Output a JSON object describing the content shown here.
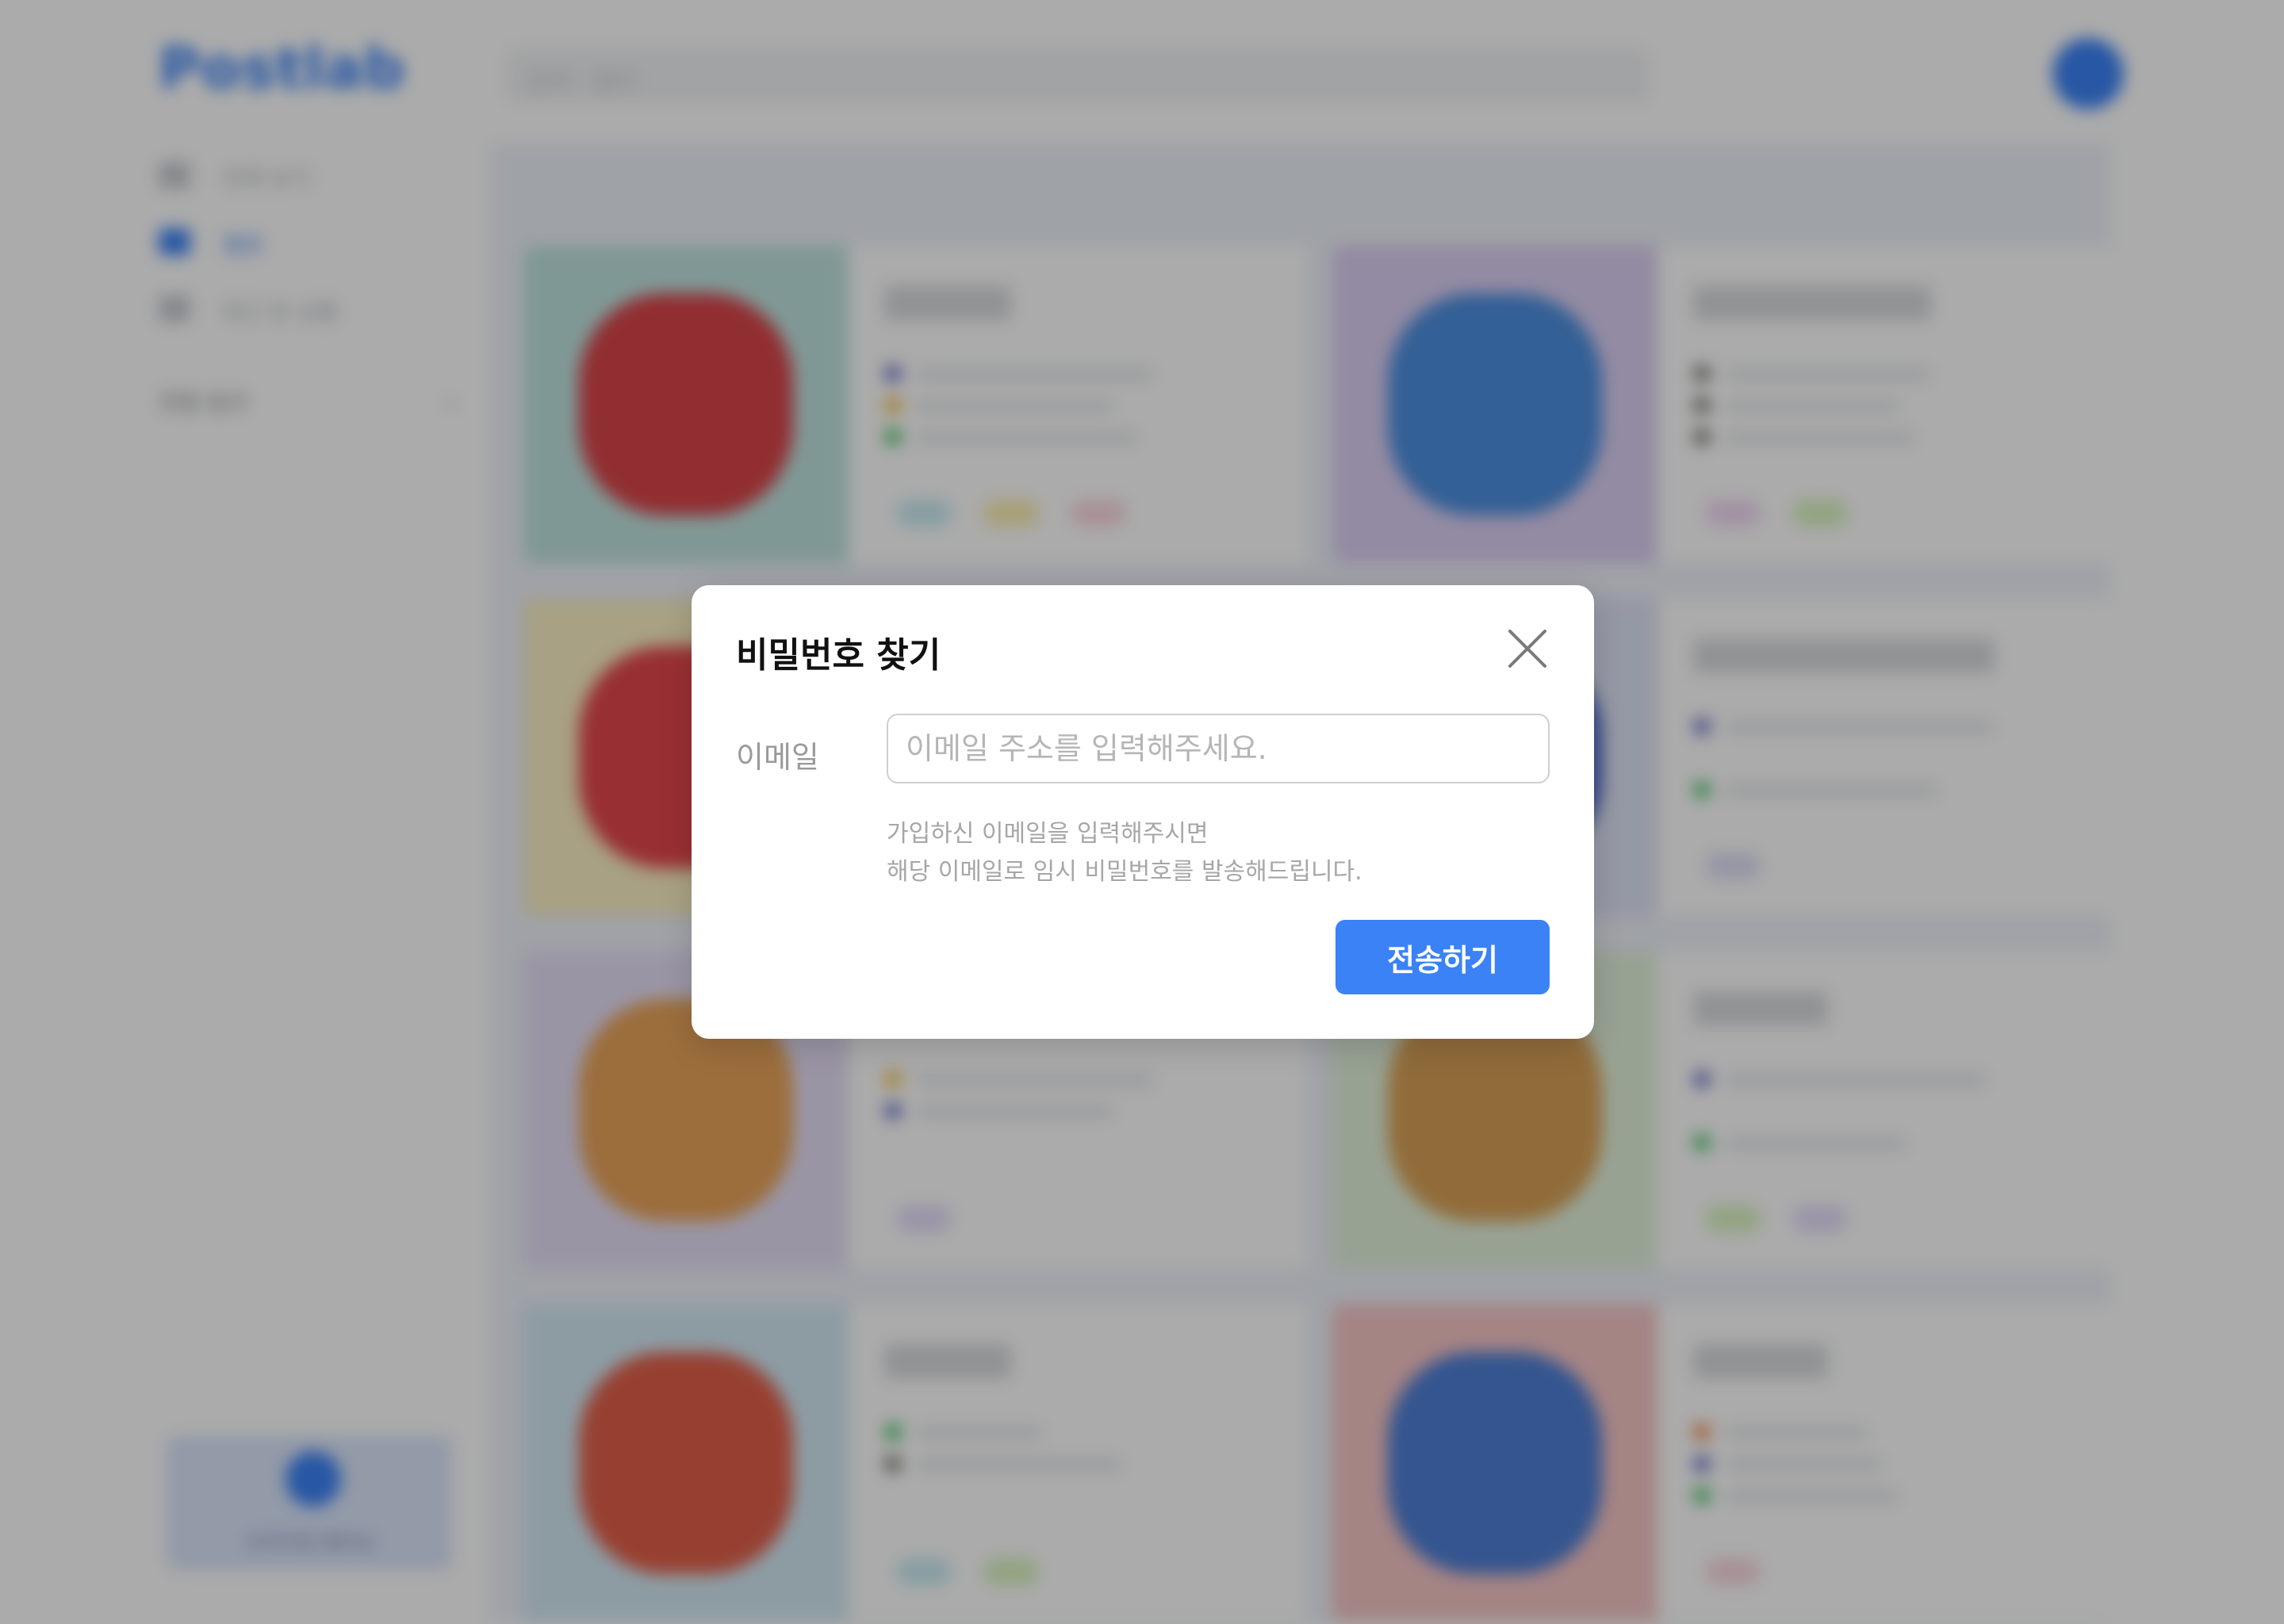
{
  "app": {
    "logo": "Postlab",
    "search_placeholder": "검색 · 필터",
    "sidebar": {
      "items": [
        {
          "label": "전체 보기"
        },
        {
          "label": "찜한"
        },
        {
          "label": "최근 본 상품"
        }
      ],
      "filter_label": "정렬 옵션",
      "card_text": "프리미엄 멤버십"
    }
  },
  "modal": {
    "title": "비밀번호 찾기",
    "email_label": "이메일",
    "email_value": "",
    "email_placeholder": "이메일 주소를 입력해주세요.",
    "help_line1": "가입하신 이메일을 입력해주시면",
    "help_line2": "해당 이메일로 임시 비밀번호를 발송해드립니다.",
    "submit_label": "전송하기"
  },
  "colors": {
    "accent": "#3b82f6",
    "overlay": "rgba(0,0,0,0.33)"
  },
  "icons": {
    "close": "close-icon"
  }
}
